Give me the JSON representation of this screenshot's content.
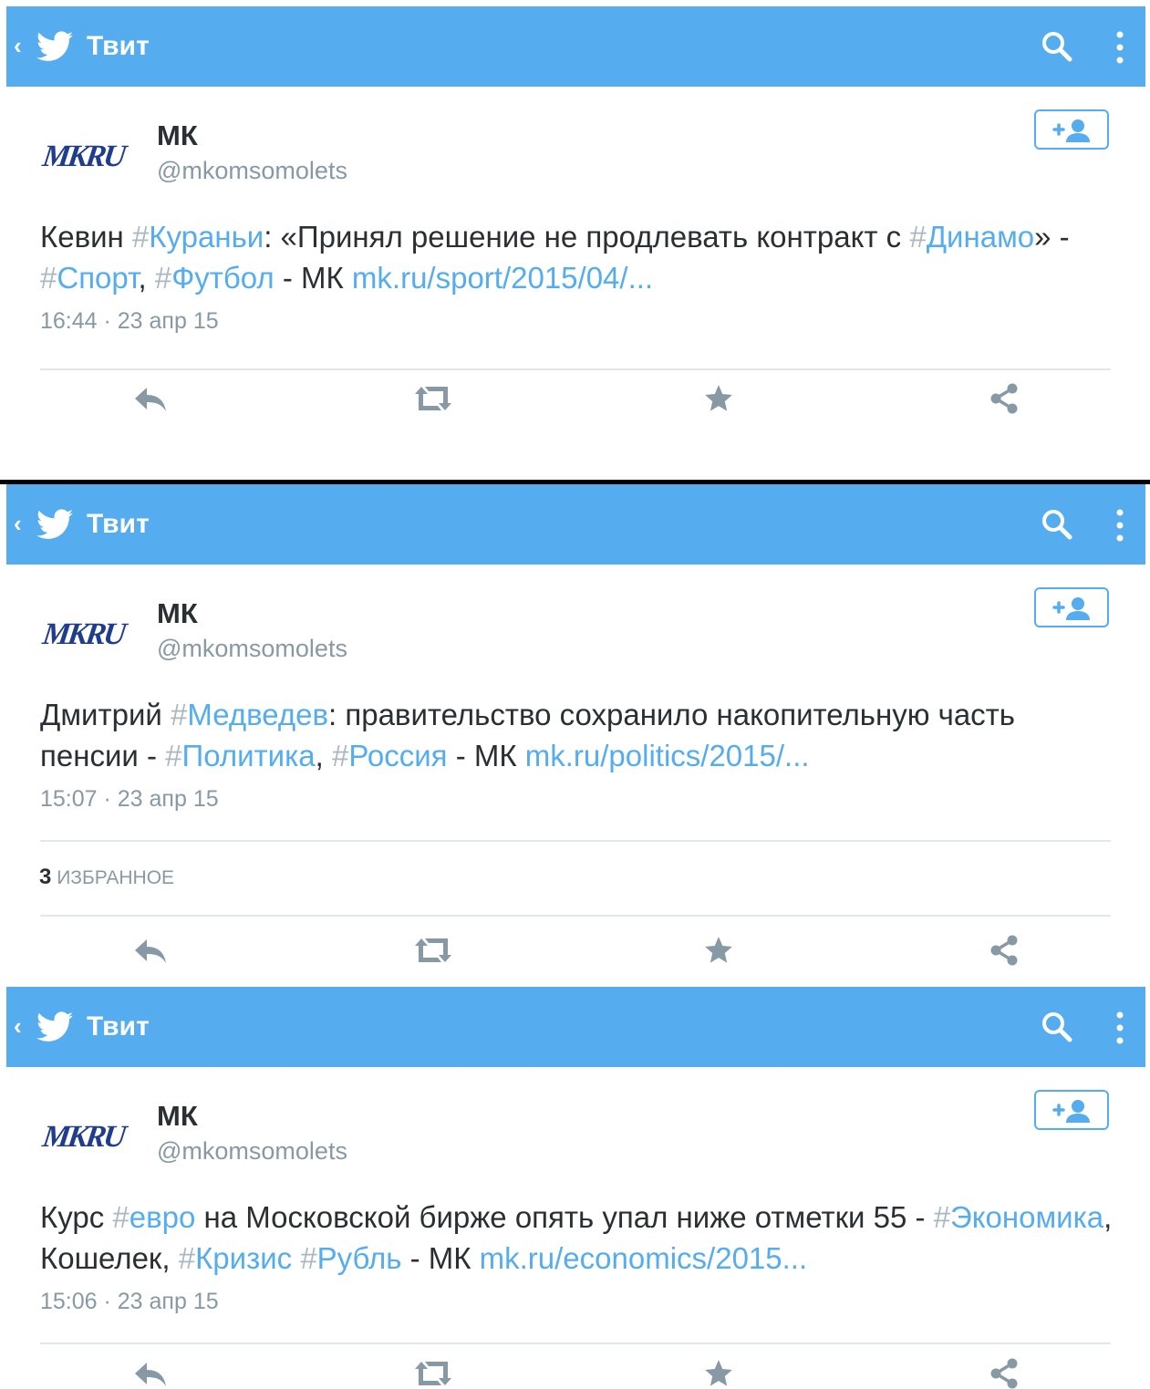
{
  "colors": {
    "accent": "#55acee",
    "icon_gray": "#8899a6"
  },
  "tweets": [
    {
      "bar_title": "Твит",
      "author": {
        "name": "МК",
        "handle": "@mkomsomolets",
        "avatar_text": "MKRU"
      },
      "text_parts": [
        {
          "t": "Кевин ",
          "k": "plain"
        },
        {
          "t": "#",
          "k": "hash"
        },
        {
          "t": "Кураньи",
          "k": "tag"
        },
        {
          "t": ": «Принял решение не продлевать контракт с ",
          "k": "plain"
        },
        {
          "t": "#",
          "k": "hash"
        },
        {
          "t": "Динамо",
          "k": "tag"
        },
        {
          "t": "» - ",
          "k": "plain"
        },
        {
          "t": "#",
          "k": "hash"
        },
        {
          "t": "Спорт",
          "k": "tag"
        },
        {
          "t": ", ",
          "k": "plain"
        },
        {
          "t": "#",
          "k": "hash"
        },
        {
          "t": "Футбол",
          "k": "tag"
        },
        {
          "t": " - МК ",
          "k": "plain"
        },
        {
          "t": "mk.ru/sport/2015/04/...",
          "k": "link"
        }
      ],
      "time": "16:44 · 23 апр 15",
      "favorites": null
    },
    {
      "bar_title": "Твит",
      "author": {
        "name": "МК",
        "handle": "@mkomsomolets",
        "avatar_text": "MKRU"
      },
      "text_parts": [
        {
          "t": "Дмитрий ",
          "k": "plain"
        },
        {
          "t": "#",
          "k": "hash"
        },
        {
          "t": "Медведев",
          "k": "tag"
        },
        {
          "t": ": правительство сохранило накопительную часть пенсии - ",
          "k": "plain"
        },
        {
          "t": "#",
          "k": "hash"
        },
        {
          "t": "Политика",
          "k": "tag"
        },
        {
          "t": ", ",
          "k": "plain"
        },
        {
          "t": "#",
          "k": "hash"
        },
        {
          "t": "Россия",
          "k": "tag"
        },
        {
          "t": " - МК ",
          "k": "plain"
        },
        {
          "t": "mk.ru/politics/2015/...",
          "k": "link"
        }
      ],
      "time": "15:07 · 23 апр 15",
      "favorites": {
        "count": "3",
        "label": "ИЗБРАННОЕ"
      }
    },
    {
      "bar_title": "Твит",
      "author": {
        "name": "МК",
        "handle": "@mkomsomolets",
        "avatar_text": "MKRU"
      },
      "text_parts": [
        {
          "t": "Курс ",
          "k": "plain"
        },
        {
          "t": "#",
          "k": "hash"
        },
        {
          "t": "евро",
          "k": "tag"
        },
        {
          "t": " на Московской бирже опять упал ниже отметки 55 - ",
          "k": "plain"
        },
        {
          "t": "#",
          "k": "hash"
        },
        {
          "t": "Экономика",
          "k": "tag"
        },
        {
          "t": ", Кошелек, ",
          "k": "plain"
        },
        {
          "t": "#",
          "k": "hash"
        },
        {
          "t": "Кризис",
          "k": "tag"
        },
        {
          "t": " ",
          "k": "plain"
        },
        {
          "t": "#",
          "k": "hash"
        },
        {
          "t": "Рубль",
          "k": "tag"
        },
        {
          "t": " - МК ",
          "k": "plain"
        },
        {
          "t": "mk.ru/economics/2015...",
          "k": "link"
        }
      ],
      "time": "15:06 · 23 апр 15",
      "favorites": null
    }
  ],
  "icons": {
    "back": "‹",
    "bird": "twitter-bird-icon",
    "search": "search-icon",
    "more": "more-vertical-icon",
    "follow": "add-user-icon",
    "reply": "reply-icon",
    "retweet": "retweet-icon",
    "favorite": "star-icon",
    "share": "share-icon"
  }
}
